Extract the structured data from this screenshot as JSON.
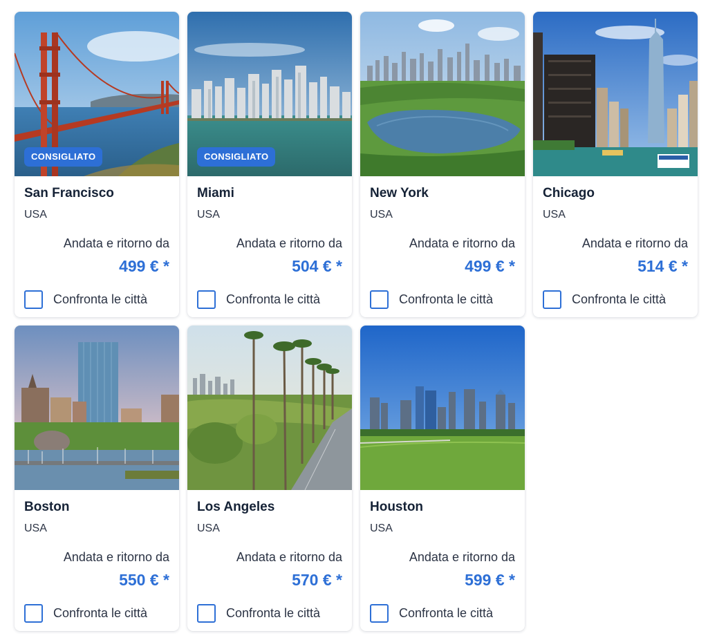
{
  "destinations": [
    {
      "city": "San Francisco",
      "country": "USA",
      "from_label": "Andata e ritorno da",
      "price": "499 € *",
      "badge": "CONSIGLIATO",
      "compare_label": "Confronta le città",
      "compare_checked": false,
      "image_subject": "golden-gate-bridge"
    },
    {
      "city": "Miami",
      "country": "USA",
      "from_label": "Andata e ritorno da",
      "price": "504 € *",
      "badge": "CONSIGLIATO",
      "compare_label": "Confronta le città",
      "compare_checked": false,
      "image_subject": "miami-skyline-bay"
    },
    {
      "city": "New York",
      "country": "USA",
      "from_label": "Andata e ritorno da",
      "price": "499 € *",
      "compare_label": "Confronta le città",
      "compare_checked": false,
      "image_subject": "central-park-reservoir"
    },
    {
      "city": "Chicago",
      "country": "USA",
      "from_label": "Andata e ritorno da",
      "price": "514 € *",
      "compare_label": "Confronta le città",
      "compare_checked": false,
      "image_subject": "chicago-river-towers"
    },
    {
      "city": "Boston",
      "country": "USA",
      "from_label": "Andata e ritorno da",
      "price": "550 € *",
      "compare_label": "Confronta le città",
      "compare_checked": false,
      "image_subject": "boston-harbor-skyline"
    },
    {
      "city": "Los Angeles",
      "country": "USA",
      "from_label": "Andata e ritorno da",
      "price": "570 € *",
      "compare_label": "Confronta le città",
      "compare_checked": false,
      "image_subject": "palm-tree-road"
    },
    {
      "city": "Houston",
      "country": "USA",
      "from_label": "Andata e ritorno da",
      "price": "599 € *",
      "compare_label": "Confronta le città",
      "compare_checked": false,
      "image_subject": "houston-skyline-park"
    }
  ],
  "colors": {
    "accent": "#2d6fd6",
    "badge_bg": "#2d6fd6",
    "text_primary": "#152236",
    "text_secondary": "#2b3344"
  }
}
